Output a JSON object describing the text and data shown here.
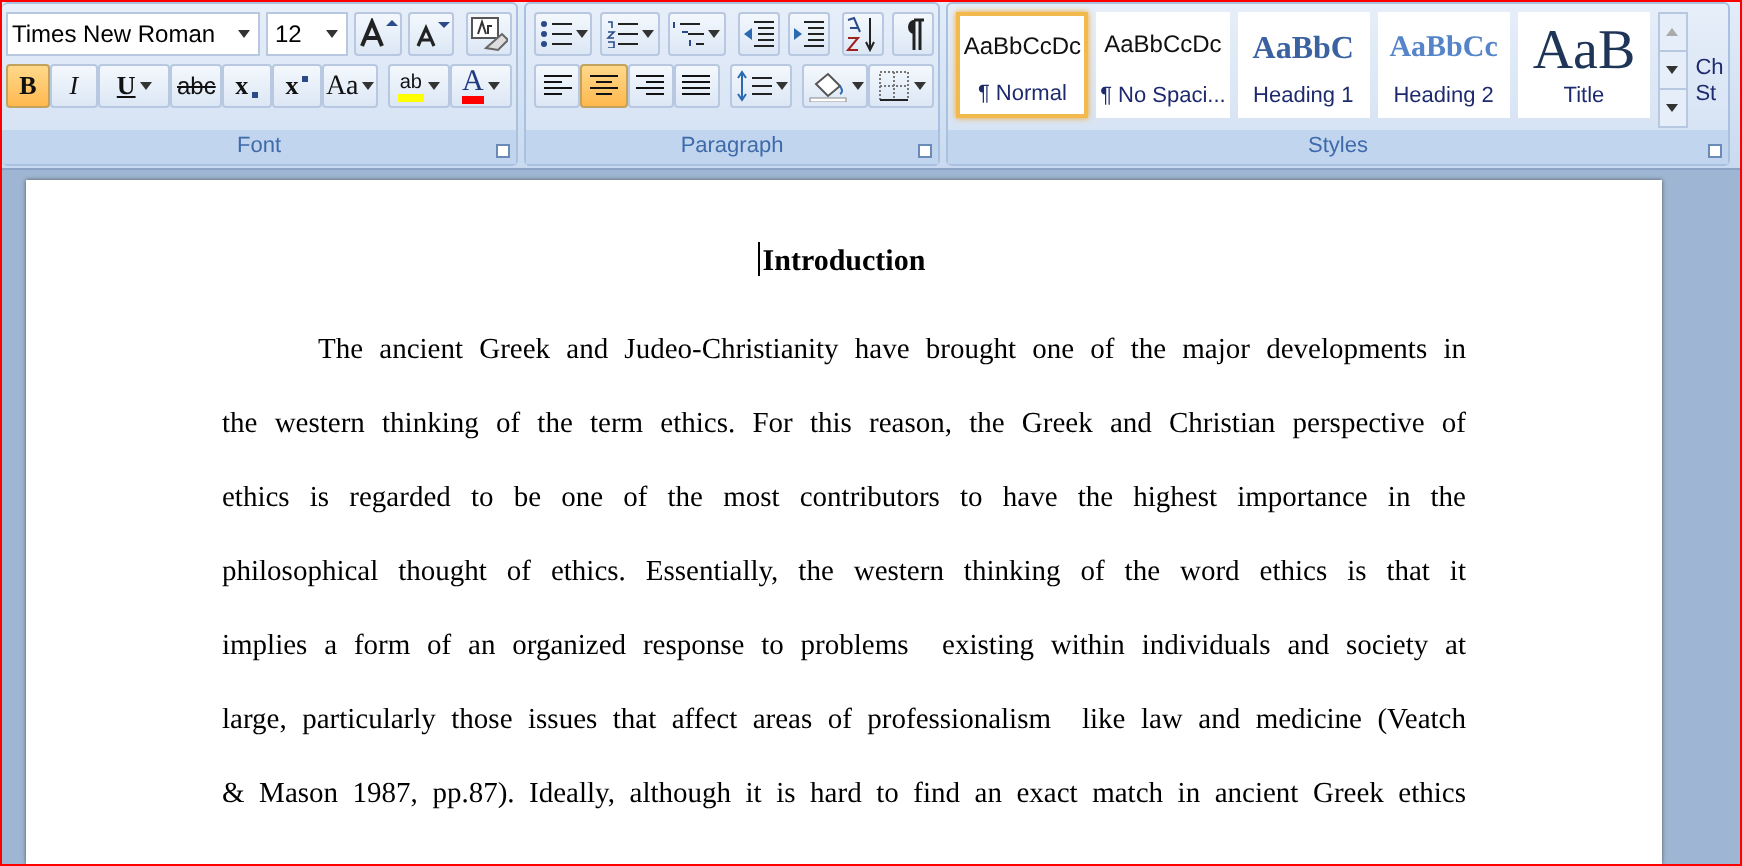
{
  "ribbon": {
    "font": {
      "label": "Font",
      "font_name": "Times New Roman",
      "font_size": "12",
      "row_1_buttons": [
        {
          "kind": "grow"
        },
        {
          "kind": "shrink"
        },
        {
          "kind": "clear"
        }
      ],
      "format_buttons": [
        {
          "label": "B",
          "kind": "bold",
          "selected": true
        },
        {
          "label": "I",
          "kind": "italic",
          "selected": false
        },
        {
          "label": "U",
          "kind": "underline",
          "selected": false
        },
        {
          "label": "abc",
          "kind": "strike",
          "selected": false
        },
        {
          "label": "x",
          "kind": "sub",
          "selected": false
        },
        {
          "label": "x",
          "kind": "sup",
          "selected": false
        },
        {
          "label": "Aa",
          "kind": "case",
          "selected": false
        },
        {
          "label": "ab",
          "kind": "highlight",
          "color": "#ffff00",
          "selected": false
        },
        {
          "label": "A",
          "kind": "fontcolor",
          "color": "#ff0000",
          "selected": false
        }
      ]
    },
    "paragraph": {
      "label": "Paragraph",
      "row_1_buttons": [
        {
          "kind": "bullets"
        },
        {
          "kind": "numbering"
        },
        {
          "kind": "multilevel"
        },
        {
          "kind": "outdent"
        },
        {
          "kind": "indent"
        },
        {
          "kind": "sort"
        },
        {
          "kind": "pilcrow"
        }
      ],
      "alignment": [
        {
          "kind": "left",
          "selected": false
        },
        {
          "kind": "center",
          "selected": true
        },
        {
          "kind": "right",
          "selected": false
        },
        {
          "kind": "justify",
          "selected": false
        }
      ],
      "row_2_buttons": [
        {
          "kind": "spacing"
        },
        {
          "kind": "shading"
        },
        {
          "kind": "borders"
        }
      ]
    },
    "styles": {
      "label": "Styles",
      "change_styles_label": [
        "Ch",
        "St"
      ],
      "items": [
        {
          "preview": "AaBbCcDc",
          "name": "¶ Normal",
          "kind": "normal",
          "selected": true
        },
        {
          "preview": "AaBbCcDc",
          "name": "¶ No Spaci...",
          "kind": "normal",
          "selected": false
        },
        {
          "preview": "AaBbC",
          "name": "Heading 1",
          "kind": "heading1",
          "selected": false
        },
        {
          "preview": "AaBbCc",
          "name": "Heading 2",
          "kind": "heading2",
          "selected": false
        },
        {
          "preview": "AaB",
          "name": "Title",
          "kind": "title",
          "selected": false
        }
      ]
    }
  },
  "document": {
    "heading": "Introduction",
    "lines": [
      "The ancient Greek and Judeo-Christianity have brought one of the major developments in",
      "the western thinking of the term ethics. For this reason, the Greek and Christian perspective of",
      "ethics is regarded to be one of the most contributors to have the highest importance in the",
      "philosophical thought of ethics. Essentially, the western thinking of the word ethics is that it",
      "implies a form of an organized response to problems  existing within individuals and society at",
      "large, particularly those issues that affect areas of professionalism  like law and medicine (Veatch",
      "& Mason 1987, pp.87). Ideally, although it is hard to find an exact match in ancient Greek ethics"
    ]
  }
}
